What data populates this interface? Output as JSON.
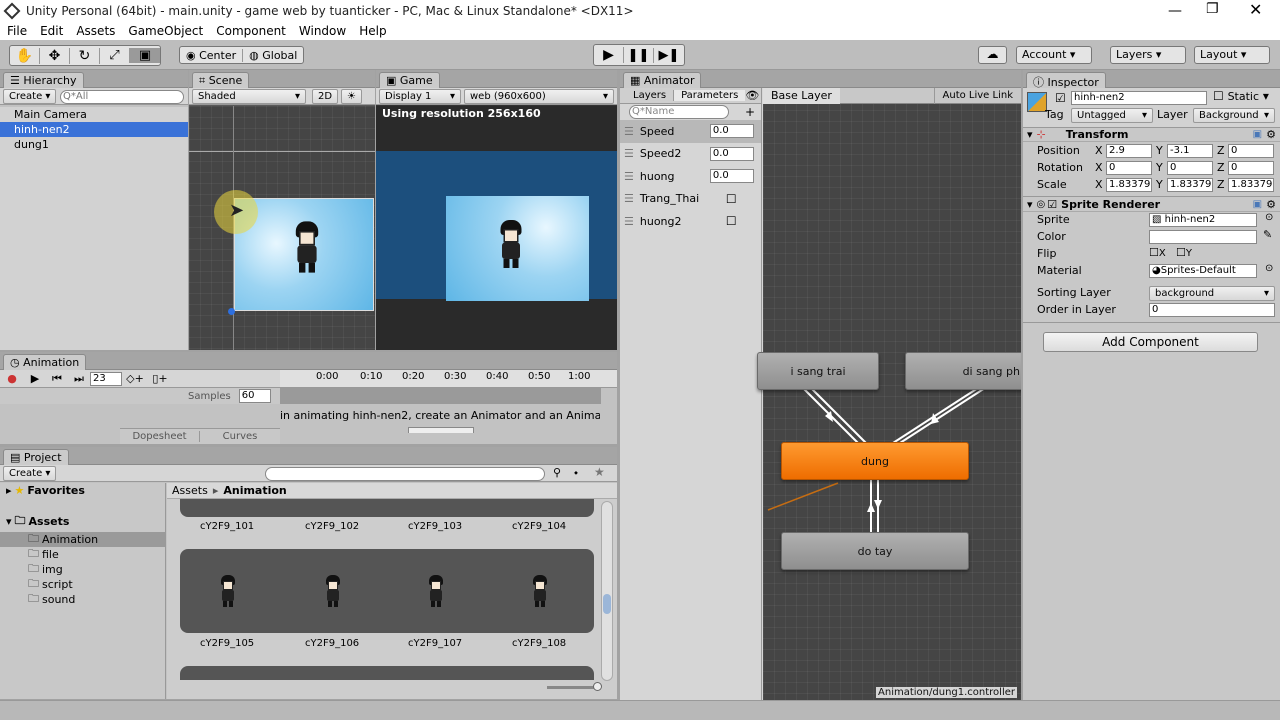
{
  "window": {
    "title": "Unity Personal (64bit) - main.unity - game web by tuanticker - PC, Mac & Linux Standalone* <DX11>"
  },
  "menu": [
    "File",
    "Edit",
    "Assets",
    "GameObject",
    "Component",
    "Window",
    "Help"
  ],
  "toolbar": {
    "center": "Center",
    "global": "Global",
    "account": "Account",
    "layers": "Layers",
    "layout": "Layout"
  },
  "hierarchy": {
    "tab": "Hierarchy",
    "create": "Create",
    "search_placeholder": "Q*All",
    "items": [
      "Main Camera",
      "hinh-nen2",
      "dung1"
    ]
  },
  "scene": {
    "tab": "Scene",
    "shading": "Shaded",
    "mode2d": "2D"
  },
  "game": {
    "tab": "Game",
    "display": "Display 1",
    "resolution": "web (960x600)",
    "info": "Using resolution 256x160"
  },
  "animation": {
    "tab": "Animation",
    "frame": "23",
    "samples_label": "Samples",
    "samples": "60",
    "ticks": [
      "0:00",
      "0:10",
      "0:20",
      "0:30",
      "0:40",
      "0:50",
      "1:00"
    ],
    "message": "in animating hinh-nen2, create an Animator and an Animatic",
    "dopesheet": "Dopesheet",
    "curves": "Curves"
  },
  "project": {
    "tab": "Project",
    "create": "Create",
    "favorites": "Favorites",
    "assets": "Assets",
    "folders": [
      "Animation",
      "file",
      "img",
      "script",
      "sound"
    ],
    "breadcrumb_root": "Assets",
    "breadcrumb_current": "Animation",
    "row1": [
      "cY2F9_101",
      "cY2F9_102",
      "cY2F9_103",
      "cY2F9_104"
    ],
    "row2": [
      "cY2F9_105",
      "cY2F9_106",
      "cY2F9_107",
      "cY2F9_108"
    ]
  },
  "animator": {
    "tab": "Animator",
    "layers": "Layers",
    "parameters": "Parameters",
    "name_placeholder": "Q*Name",
    "params": [
      {
        "name": "Speed",
        "value": "0.0",
        "kind": "float"
      },
      {
        "name": "Speed2",
        "value": "0.0",
        "kind": "float"
      },
      {
        "name": "huong",
        "value": "0.0",
        "kind": "float"
      },
      {
        "name": "Trang_Thai",
        "value": "",
        "kind": "bool"
      },
      {
        "name": "huong2",
        "value": "",
        "kind": "bool"
      }
    ],
    "base_layer": "Base Layer",
    "auto_live_link": "Auto Live Link",
    "states": {
      "left": "i sang trai",
      "right": "di sang ph",
      "dung": "dung",
      "dotay": "do tay"
    },
    "controller_path": "Animation/dung1.controller"
  },
  "inspector": {
    "tab": "Inspector",
    "name": "hinh-nen2",
    "static": "Static",
    "tag_label": "Tag",
    "tag": "Untagged",
    "layer_label": "Layer",
    "layer": "Background",
    "transform": {
      "title": "Transform",
      "position_label": "Position",
      "rotation_label": "Rotation",
      "scale_label": "Scale",
      "position": [
        "2.9",
        "-3.1",
        "0"
      ],
      "rotation": [
        "0",
        "0",
        "0"
      ],
      "scale": [
        "1.83379",
        "1.83379",
        "1.83379"
      ]
    },
    "sprite_renderer": {
      "title": "Sprite Renderer",
      "sprite_label": "Sprite",
      "sprite": "hinh-nen2",
      "color_label": "Color",
      "flip_label": "Flip",
      "flip_x": "X",
      "flip_y": "Y",
      "material_label": "Material",
      "material": "Sprites-Default",
      "sorting_layer_label": "Sorting Layer",
      "sorting_layer": "background",
      "order_label": "Order in Layer",
      "order": "0"
    },
    "add_component": "Add Component"
  },
  "axis": {
    "x": "X",
    "y": "Y",
    "z": "Z"
  }
}
